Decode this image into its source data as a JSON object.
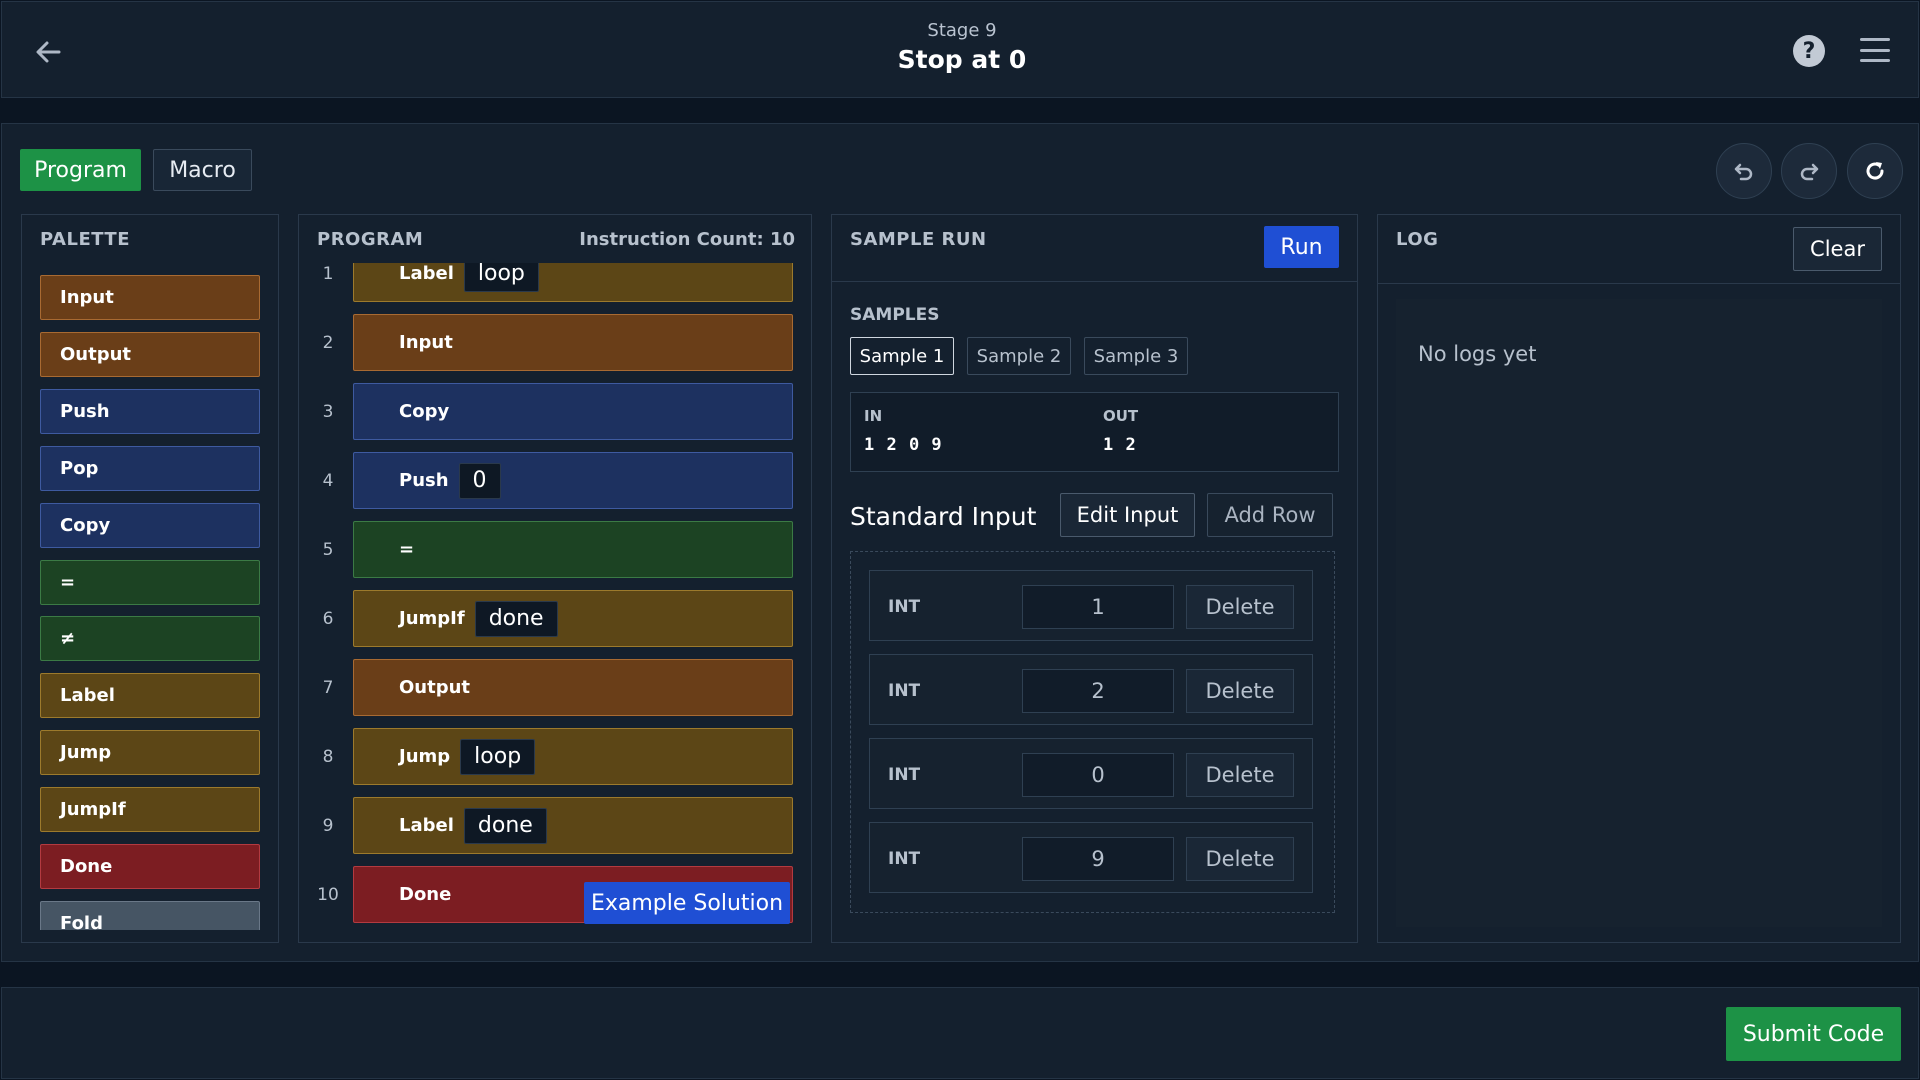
{
  "header": {
    "stage": "Stage 9",
    "title": "Stop at 0",
    "help_glyph": "?"
  },
  "tabs": {
    "program": "Program",
    "macro": "Macro"
  },
  "palette": {
    "title": "PALETTE",
    "items": [
      {
        "label": "Input",
        "color": "orange"
      },
      {
        "label": "Output",
        "color": "orange"
      },
      {
        "label": "Push",
        "color": "blue"
      },
      {
        "label": "Pop",
        "color": "blue"
      },
      {
        "label": "Copy",
        "color": "blue"
      },
      {
        "label": "=",
        "color": "green"
      },
      {
        "label": "≠",
        "color": "green"
      },
      {
        "label": "Label",
        "color": "yellow"
      },
      {
        "label": "Jump",
        "color": "yellow"
      },
      {
        "label": "JumpIf",
        "color": "yellow"
      },
      {
        "label": "Done",
        "color": "red"
      },
      {
        "label": "Fold",
        "color": "grey"
      }
    ]
  },
  "program": {
    "title": "PROGRAM",
    "instruction_count": "Instruction Count: 10",
    "lines": [
      {
        "no": "1",
        "op": "Label",
        "arg": "loop",
        "color": "yellow"
      },
      {
        "no": "2",
        "op": "Input",
        "arg": null,
        "color": "orange"
      },
      {
        "no": "3",
        "op": "Copy",
        "arg": null,
        "color": "blue"
      },
      {
        "no": "4",
        "op": "Push",
        "arg": "0",
        "color": "blue"
      },
      {
        "no": "5",
        "op": "=",
        "arg": null,
        "color": "green"
      },
      {
        "no": "6",
        "op": "JumpIf",
        "arg": "done",
        "color": "yellow"
      },
      {
        "no": "7",
        "op": "Output",
        "arg": null,
        "color": "orange"
      },
      {
        "no": "8",
        "op": "Jump",
        "arg": "loop",
        "color": "yellow"
      },
      {
        "no": "9",
        "op": "Label",
        "arg": "done",
        "color": "yellow"
      },
      {
        "no": "10",
        "op": "Done",
        "arg": null,
        "color": "red"
      }
    ],
    "example_solution": "Example Solution"
  },
  "sample_run": {
    "title": "SAMPLE RUN",
    "run": "Run",
    "samples_label": "SAMPLES",
    "samples": [
      "Sample 1",
      "Sample 2",
      "Sample 3"
    ],
    "active_sample": 0,
    "in_label": "IN",
    "in_values": "1 2 0 9",
    "out_label": "OUT",
    "out_values": "1 2",
    "standard_input_label": "Standard Input",
    "edit_input": "Edit Input",
    "add_row": "Add Row",
    "rows": [
      {
        "type": "INT",
        "value": "1",
        "delete": "Delete"
      },
      {
        "type": "INT",
        "value": "2",
        "delete": "Delete"
      },
      {
        "type": "INT",
        "value": "0",
        "delete": "Delete"
      },
      {
        "type": "INT",
        "value": "9",
        "delete": "Delete"
      }
    ]
  },
  "log": {
    "title": "LOG",
    "clear": "Clear",
    "empty": "No logs yet"
  },
  "footer": {
    "submit": "Submit Code"
  },
  "colors": {
    "accent_green": "#1d9246",
    "accent_blue": "#1f4fd4",
    "background": "#0b1522",
    "panel": "#14202e"
  },
  "icons": [
    "back-arrow-icon",
    "help-icon",
    "menu-icon",
    "undo-icon",
    "redo-icon",
    "reset-icon"
  ]
}
